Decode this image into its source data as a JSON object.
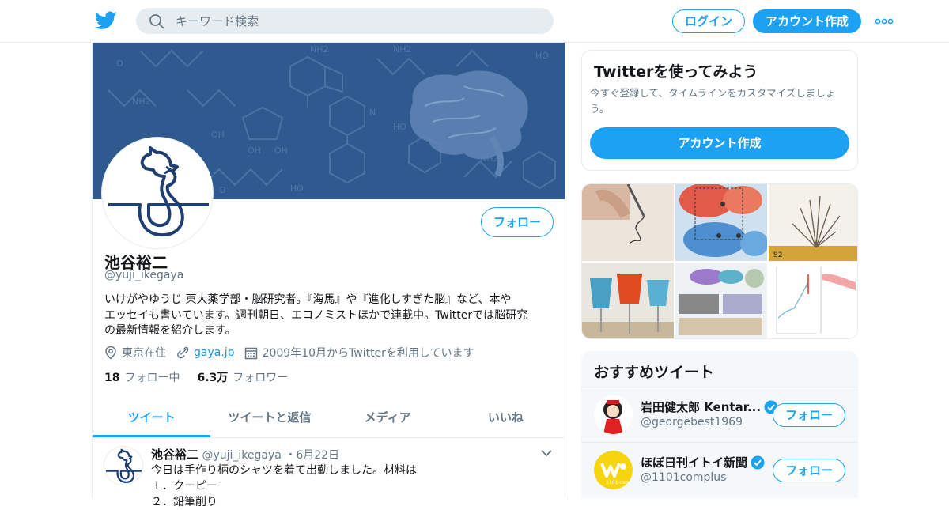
{
  "topbar": {
    "search_placeholder": "キーワード検索",
    "login_label": "ログイン",
    "signup_label": "アカウント作成"
  },
  "profile": {
    "name": "池谷裕二",
    "handle": "@yuji_ikegaya",
    "follow_label": "フォロー",
    "bio_lines": [
      "いけがやゆうじ 東大薬学部・脳研究者。『海馬』や『進化しすぎた脳』など、本や",
      "エッセイも書いています。週刊朝日、エコノミストほかで連載中。Twitterでは脳研究",
      "の最新情報を紹介します。"
    ],
    "location": "東京在住",
    "website": "gaya.jp",
    "joined": "2009年10月からTwitterを利用しています",
    "following_count": "18",
    "following_label": "フォロー中",
    "followers_count": "6.3万",
    "followers_label": "フォロワー"
  },
  "tabs": [
    "ツイート",
    "ツイートと返信",
    "メディア",
    "いいね"
  ],
  "tweet": {
    "name": "池谷裕二",
    "handle": "@yuji_ikegaya",
    "date": "6月22日",
    "lines": [
      "今日は手作り柄のシャツを着て出勤しました。材料は",
      "１．クーピー",
      "２．鉛筆削り"
    ]
  },
  "signup_card": {
    "title": "Twitterを使ってみよう",
    "description": "今すぐ登録して、タイムラインをカスタマイズしましょう。",
    "button": "アカウント作成"
  },
  "recommended": {
    "title": "おすすめツイート",
    "accounts": [
      {
        "name": "岩田健太郎 Kentar...",
        "handle": "@georgebest1969",
        "follow": "フォロー"
      },
      {
        "name": "ほぼ日刊イトイ新聞",
        "handle": "@1101complus",
        "follow": "フォロー"
      }
    ]
  },
  "colors": {
    "accent": "#1da1f2",
    "banner": "#2f5a8f",
    "secondary_text": "#657786"
  }
}
